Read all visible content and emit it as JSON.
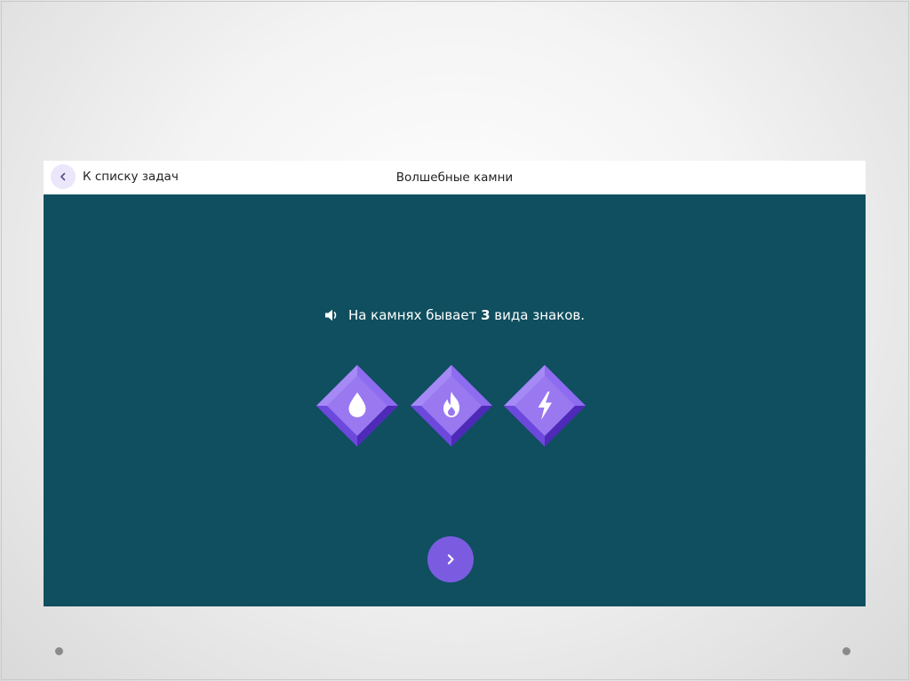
{
  "header": {
    "back_label": "К списку задач",
    "title": "Волшебные камни"
  },
  "instruction": {
    "prefix": "На камнях бывает ",
    "count": "3",
    "suffix": " вида знаков."
  },
  "gems": [
    {
      "symbol": "water-drop-icon"
    },
    {
      "symbol": "fire-icon"
    },
    {
      "symbol": "lightning-icon"
    }
  ],
  "colors": {
    "panel_bg": "#0f4f5f",
    "accent": "#7b5ce0",
    "gem_light": "#9a78f0",
    "gem_dark": "#5b36c9"
  }
}
